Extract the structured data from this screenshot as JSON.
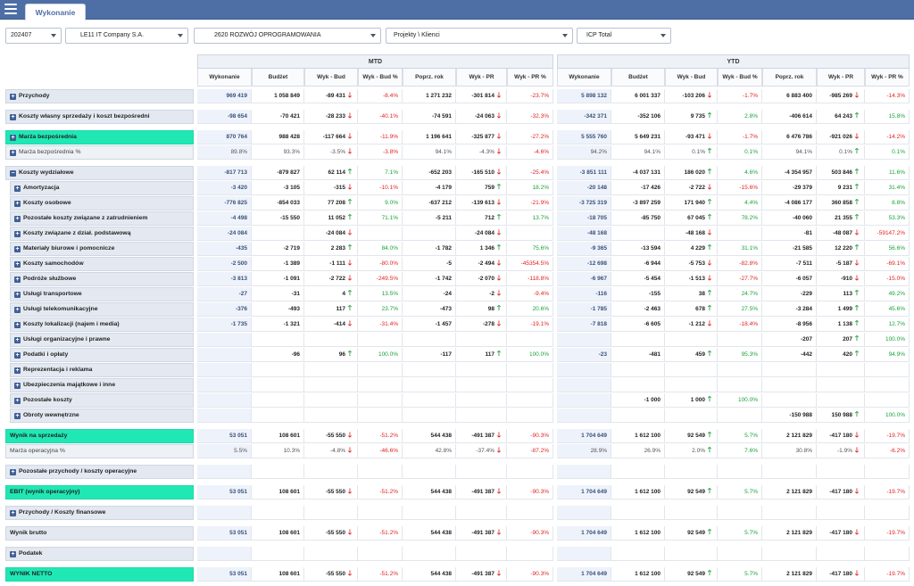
{
  "header": {
    "tab_label": "Wykonanie"
  },
  "filters": {
    "period": "202407",
    "company": "LE11 IT Company S.A.",
    "department": "2620 ROZWÓJ OPROGRAMOWANIA",
    "project": "Projekty \\ Klienci",
    "icp": "ICP Total"
  },
  "groups": {
    "mtd": "MTD",
    "ytd": "YTD"
  },
  "columns": [
    "Wykonanie",
    "Budżet",
    "Wyk - Bud",
    "Wyk - Bud %",
    "Poprz. rok",
    "Wyk - PR",
    "Wyk - PR %"
  ],
  "rows": [
    {
      "label": "Przychody",
      "exp": "+",
      "indent": 0,
      "style": "bold",
      "gap": 0,
      "mtd": [
        "969 419",
        "1 058 849",
        "-89 431",
        "-8.4%",
        "1 271 232",
        "-301 814",
        "-23.7%"
      ],
      "ytd": [
        "5 898 132",
        "6 001 337",
        "-103 206",
        "-1.7%",
        "6 883 400",
        "-985 269",
        "-14.3%"
      ],
      "a": [
        "down",
        "down",
        "down",
        "down"
      ]
    },
    {
      "label": "Koszty własny sprzedaży i koszt bezpośredni",
      "exp": "+",
      "indent": 0,
      "style": "bold",
      "gap": 6,
      "mtd": [
        "-98 654",
        "-70 421",
        "-28 233",
        "-40.1%",
        "-74 591",
        "-24 063",
        "-32.3%"
      ],
      "ytd": [
        "-342 371",
        "-352 106",
        "9 735",
        "2.8%",
        "-406 614",
        "64 243",
        "15.8%"
      ],
      "a": [
        "down",
        "down",
        "up",
        "up"
      ]
    },
    {
      "label": "Marża bezpośrednia",
      "exp": "+",
      "indent": 0,
      "style": "hl",
      "gap": 6,
      "mtd": [
        "870 764",
        "988 428",
        "-117 664",
        "-11.9%",
        "1 196 641",
        "-325 877",
        "-27.2%"
      ],
      "ytd": [
        "5 555 760",
        "5 649 231",
        "-93 471",
        "-1.7%",
        "6 476 786",
        "-921 026",
        "-14.2%"
      ],
      "a": [
        "down",
        "down",
        "down",
        "down"
      ]
    },
    {
      "label": "Marża bezpośrednia %",
      "exp": "+",
      "indent": 0,
      "style": "sub",
      "gap": 0,
      "mtd": [
        "89.8%",
        "93.3%",
        "-3.5%",
        "-3.8%",
        "94.1%",
        "-4.3%",
        "-4.6%"
      ],
      "ytd": [
        "94.2%",
        "94.1%",
        "0.1%",
        "0.1%",
        "94.1%",
        "0.1%",
        "0.1%"
      ],
      "a": [
        "down",
        "down",
        "up",
        "up"
      ]
    },
    {
      "label": "Koszty wydziałowe",
      "exp": "−",
      "indent": 0,
      "style": "bold",
      "gap": 6,
      "mtd": [
        "-817 713",
        "-879 827",
        "62 114",
        "7.1%",
        "-652 203",
        "-165 510",
        "-25.4%"
      ],
      "ytd": [
        "-3 851 111",
        "-4 037 131",
        "186 020",
        "4.6%",
        "-4 354 957",
        "503 846",
        "11.6%"
      ],
      "a": [
        "up",
        "down",
        "up",
        "up"
      ]
    },
    {
      "label": "Amortyzacja",
      "exp": "+",
      "indent": 1,
      "style": "bold",
      "gap": 0,
      "mtd": [
        "-3 420",
        "-3 105",
        "-315",
        "-10.1%",
        "-4 179",
        "759",
        "18.2%"
      ],
      "ytd": [
        "-20 148",
        "-17 426",
        "-2 722",
        "-15.6%",
        "-29 379",
        "9 231",
        "31.4%"
      ],
      "a": [
        "down",
        "up",
        "down",
        "up"
      ]
    },
    {
      "label": "Koszty osobowe",
      "exp": "+",
      "indent": 1,
      "style": "bold",
      "gap": 0,
      "mtd": [
        "-776 825",
        "-854 033",
        "77 208",
        "9.0%",
        "-637 212",
        "-139 613",
        "-21.9%"
      ],
      "ytd": [
        "-3 725 319",
        "-3 897 259",
        "171 940",
        "4.4%",
        "-4 086 177",
        "360 858",
        "8.8%"
      ],
      "a": [
        "up",
        "down",
        "up",
        "up"
      ]
    },
    {
      "label": "Pozostałe koszty związane z zatrudnieniem",
      "exp": "+",
      "indent": 1,
      "style": "bold",
      "gap": 0,
      "mtd": [
        "-4 498",
        "-15 550",
        "11 052",
        "71.1%",
        "-5 211",
        "712",
        "13.7%"
      ],
      "ytd": [
        "-18 705",
        "-85 750",
        "67 045",
        "78.2%",
        "-40 060",
        "21 355",
        "53.3%"
      ],
      "a": [
        "up",
        "up",
        "up",
        "up"
      ]
    },
    {
      "label": "Koszty związane z dział. podstawową",
      "exp": "+",
      "indent": 1,
      "style": "bold",
      "gap": 0,
      "mtd": [
        "-24 084",
        "",
        "-24 084",
        "",
        "",
        "-24 084",
        ""
      ],
      "ytd": [
        "-48 168",
        "",
        "-48 168",
        "",
        "-81",
        "-48 087",
        "-59147.2%"
      ],
      "a": [
        "down",
        "down",
        "down",
        "down"
      ]
    },
    {
      "label": "Materiały biurowe i pomocnicze",
      "exp": "+",
      "indent": 1,
      "style": "bold",
      "gap": 0,
      "mtd": [
        "-435",
        "-2 719",
        "2 283",
        "84.0%",
        "-1 782",
        "1 346",
        "75.6%"
      ],
      "ytd": [
        "-9 365",
        "-13 594",
        "4 229",
        "31.1%",
        "-21 585",
        "12 220",
        "56.6%"
      ],
      "a": [
        "up",
        "up",
        "up",
        "up"
      ]
    },
    {
      "label": "Koszty samochodów",
      "exp": "+",
      "indent": 1,
      "style": "bold",
      "gap": 0,
      "mtd": [
        "-2 500",
        "-1 389",
        "-1 111",
        "-80.0%",
        "-5",
        "-2 494",
        "-45354.5%"
      ],
      "ytd": [
        "-12 698",
        "-6 944",
        "-5 753",
        "-82.8%",
        "-7 511",
        "-5 187",
        "-69.1%"
      ],
      "a": [
        "down",
        "down",
        "down",
        "down"
      ]
    },
    {
      "label": "Podróże służbowe",
      "exp": "+",
      "indent": 1,
      "style": "bold",
      "gap": 0,
      "mtd": [
        "-3 813",
        "-1 091",
        "-2 722",
        "-249.5%",
        "-1 742",
        "-2 070",
        "-118.8%"
      ],
      "ytd": [
        "-6 967",
        "-5 454",
        "-1 513",
        "-27.7%",
        "-6 057",
        "-910",
        "-15.0%"
      ],
      "a": [
        "down",
        "down",
        "down",
        "down"
      ]
    },
    {
      "label": "Usługi transportowe",
      "exp": "+",
      "indent": 1,
      "style": "bold",
      "gap": 0,
      "mtd": [
        "-27",
        "-31",
        "4",
        "13.5%",
        "-24",
        "-2",
        "-9.4%"
      ],
      "ytd": [
        "-116",
        "-155",
        "38",
        "24.7%",
        "-229",
        "113",
        "49.2%"
      ],
      "a": [
        "up",
        "down",
        "up",
        "up"
      ]
    },
    {
      "label": "Usługi telekomunikacyjne",
      "exp": "+",
      "indent": 1,
      "style": "bold",
      "gap": 0,
      "mtd": [
        "-376",
        "-493",
        "117",
        "23.7%",
        "-473",
        "98",
        "20.6%"
      ],
      "ytd": [
        "-1 785",
        "-2 463",
        "678",
        "27.5%",
        "-3 284",
        "1 499",
        "45.6%"
      ],
      "a": [
        "up",
        "up",
        "up",
        "up"
      ]
    },
    {
      "label": "Koszty lokalizacji (najem i media)",
      "exp": "+",
      "indent": 1,
      "style": "bold",
      "gap": 0,
      "mtd": [
        "-1 735",
        "-1 321",
        "-414",
        "-31.4%",
        "-1 457",
        "-278",
        "-19.1%"
      ],
      "ytd": [
        "-7 818",
        "-6 605",
        "-1 212",
        "-18.4%",
        "-8 956",
        "1 138",
        "12.7%"
      ],
      "a": [
        "down",
        "down",
        "down",
        "up"
      ]
    },
    {
      "label": "Usługi organizacyjne i prawne",
      "exp": "+",
      "indent": 1,
      "style": "bold",
      "gap": 0,
      "mtd": [
        "",
        "",
        "",
        "",
        "",
        "",
        ""
      ],
      "ytd": [
        "",
        "",
        "",
        "",
        "-207",
        "207",
        "100.0%"
      ],
      "a": [
        "",
        "",
        "",
        "up"
      ]
    },
    {
      "label": "Podatki i opłaty",
      "exp": "+",
      "indent": 1,
      "style": "bold",
      "gap": 0,
      "mtd": [
        "",
        "-96",
        "96",
        "100.0%",
        "-117",
        "117",
        "100.0%"
      ],
      "ytd": [
        "-23",
        "-481",
        "459",
        "95.3%",
        "-442",
        "420",
        "94.9%"
      ],
      "a": [
        "up",
        "up",
        "up",
        "up"
      ]
    },
    {
      "label": "Reprezentacja i reklama",
      "exp": "+",
      "indent": 1,
      "style": "bold",
      "gap": 0,
      "mtd": [
        "",
        "",
        "",
        "",
        "",
        "",
        ""
      ],
      "ytd": [
        "",
        "",
        "",
        "",
        "",
        "",
        ""
      ],
      "a": [
        "",
        "",
        "",
        ""
      ]
    },
    {
      "label": "Ubezpieczenia majątkowe i inne",
      "exp": "+",
      "indent": 1,
      "style": "bold",
      "gap": 0,
      "mtd": [
        "",
        "",
        "",
        "",
        "",
        "",
        ""
      ],
      "ytd": [
        "",
        "",
        "",
        "",
        "",
        "",
        ""
      ],
      "a": [
        "",
        "",
        "",
        ""
      ]
    },
    {
      "label": "Pozostałe koszty",
      "exp": "+",
      "indent": 1,
      "style": "bold",
      "gap": 0,
      "mtd": [
        "",
        "",
        "",
        "",
        "",
        "",
        ""
      ],
      "ytd": [
        "",
        "-1 000",
        "1 000",
        "100.0%",
        "",
        "",
        ""
      ],
      "a": [
        "",
        "",
        "up",
        ""
      ]
    },
    {
      "label": "Obroty wewnętrzne",
      "exp": "+",
      "indent": 1,
      "style": "bold",
      "gap": 0,
      "mtd": [
        "",
        "",
        "",
        "",
        "",
        "",
        ""
      ],
      "ytd": [
        "",
        "",
        "",
        "",
        "-150 988",
        "150 988",
        "100.0%"
      ],
      "a": [
        "",
        "",
        "",
        "up"
      ]
    },
    {
      "label": "Wynik na sprzedaży",
      "exp": "",
      "indent": 0,
      "style": "hl",
      "gap": 6,
      "mtd": [
        "53 051",
        "108 601",
        "-55 550",
        "-51.2%",
        "544 438",
        "-491 387",
        "-90.3%"
      ],
      "ytd": [
        "1 704 649",
        "1 612 100",
        "92 549",
        "5.7%",
        "2 121 829",
        "-417 180",
        "-19.7%"
      ],
      "a": [
        "down",
        "down",
        "up",
        "down"
      ]
    },
    {
      "label": "Marża operacyjna %",
      "exp": "",
      "indent": 0,
      "style": "sub",
      "gap": 0,
      "mtd": [
        "5.5%",
        "10.3%",
        "-4.8%",
        "-46.6%",
        "42.8%",
        "-37.4%",
        "-87.2%"
      ],
      "ytd": [
        "28.9%",
        "26.9%",
        "2.0%",
        "7.6%",
        "30.8%",
        "-1.9%",
        "-6.2%"
      ],
      "a": [
        "down",
        "down",
        "up",
        "down"
      ]
    },
    {
      "label": "Pozostałe przychody / koszty operacyjne",
      "exp": "+",
      "indent": 0,
      "style": "bold",
      "gap": 6,
      "mtd": [
        "",
        "",
        "",
        "",
        "",
        "",
        ""
      ],
      "ytd": [
        "",
        "",
        "",
        "",
        "",
        "",
        ""
      ],
      "a": [
        "",
        "",
        "",
        ""
      ]
    },
    {
      "label": "EBIT (wynik operacyjny)",
      "exp": "",
      "indent": 0,
      "style": "hl",
      "gap": 6,
      "mtd": [
        "53 051",
        "108 601",
        "-55 550",
        "-51.2%",
        "544 438",
        "-491 387",
        "-90.3%"
      ],
      "ytd": [
        "1 704 649",
        "1 612 100",
        "92 549",
        "5.7%",
        "2 121 829",
        "-417 180",
        "-19.7%"
      ],
      "a": [
        "down",
        "down",
        "up",
        "down"
      ]
    },
    {
      "label": "Przychody / Koszty finansowe",
      "exp": "+",
      "indent": 0,
      "style": "bold",
      "gap": 6,
      "mtd": [
        "",
        "",
        "",
        "",
        "",
        "",
        ""
      ],
      "ytd": [
        "",
        "",
        "",
        "",
        "",
        "",
        ""
      ],
      "a": [
        "",
        "",
        "",
        ""
      ]
    },
    {
      "label": "Wynik brutto",
      "exp": "",
      "indent": 0,
      "style": "bold",
      "gap": 6,
      "mtd": [
        "53 051",
        "108 601",
        "-55 550",
        "-51.2%",
        "544 438",
        "-491 387",
        "-90.3%"
      ],
      "ytd": [
        "1 704 649",
        "1 612 100",
        "92 549",
        "5.7%",
        "2 121 829",
        "-417 180",
        "-19.7%"
      ],
      "a": [
        "down",
        "down",
        "up",
        "down"
      ]
    },
    {
      "label": "Podatek",
      "exp": "+",
      "indent": 0,
      "style": "bold",
      "gap": 6,
      "mtd": [
        "",
        "",
        "",
        "",
        "",
        "",
        ""
      ],
      "ytd": [
        "",
        "",
        "",
        "",
        "",
        "",
        ""
      ],
      "a": [
        "",
        "",
        "",
        ""
      ]
    },
    {
      "label": "WYNIK NETTO",
      "exp": "",
      "indent": 0,
      "style": "hl",
      "gap": 6,
      "mtd": [
        "53 051",
        "108 601",
        "-55 550",
        "-51.2%",
        "544 438",
        "-491 387",
        "-90.3%"
      ],
      "ytd": [
        "1 704 649",
        "1 612 100",
        "92 549",
        "5.7%",
        "2 121 829",
        "-417 180",
        "-19.7%"
      ],
      "a": [
        "down",
        "down",
        "up",
        "down"
      ]
    }
  ]
}
